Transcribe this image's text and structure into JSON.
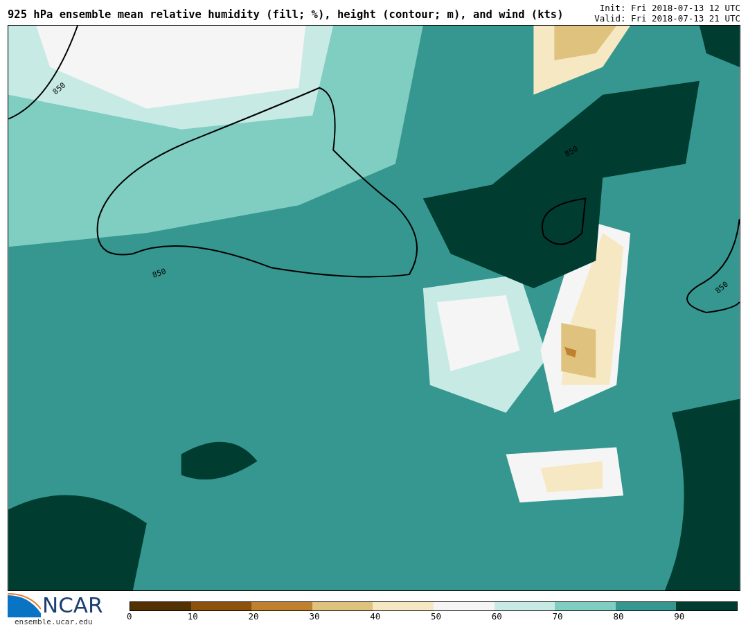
{
  "title": "925 hPa ensemble mean relative humidity (fill; %), height (contour; m), and wind (kts)",
  "init": "Init: Fri 2018-07-13 12 UTC",
  "valid": "Valid: Fri 2018-07-13 21 UTC",
  "contour_labels": [
    "850",
    "850",
    "850",
    "850"
  ],
  "logo": {
    "text": "NCAR",
    "url": "ensemble.ucar.edu"
  },
  "colorbar": {
    "segments": [
      {
        "color": "#543005"
      },
      {
        "color": "#8c510a"
      },
      {
        "color": "#bf812d"
      },
      {
        "color": "#dfc27d"
      },
      {
        "color": "#f6e8c3"
      },
      {
        "color": "#f5f5f5"
      },
      {
        "color": "#c7eae5"
      },
      {
        "color": "#80cdc1"
      },
      {
        "color": "#35978f"
      },
      {
        "color": "#003c30"
      }
    ],
    "ticks": [
      "0",
      "10",
      "20",
      "30",
      "40",
      "50",
      "60",
      "70",
      "80",
      "90"
    ]
  }
}
